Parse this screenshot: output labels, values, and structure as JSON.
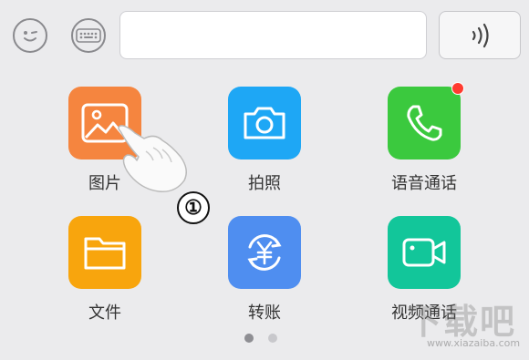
{
  "toolbar": {
    "emoji_icon": "emoji-face-icon",
    "keyboard_icon": "keyboard-icon",
    "input_value": "",
    "voice_icon": "voice-wave-icon"
  },
  "apps": [
    {
      "label": "图片",
      "icon": "image-icon",
      "color": "#f5853f"
    },
    {
      "label": "拍照",
      "icon": "camera-icon",
      "color": "#1ea7f5"
    },
    {
      "label": "语音通话",
      "icon": "phone-icon",
      "color": "#3bc93e",
      "badge": true
    },
    {
      "label": "文件",
      "icon": "folder-icon",
      "color": "#f8a50d"
    },
    {
      "label": "转账",
      "icon": "transfer-yuan-icon",
      "color": "#4f8ef0"
    },
    {
      "label": "视频通话",
      "icon": "video-camera-icon",
      "color": "#12c69a"
    }
  ],
  "pagination": {
    "pages": 2,
    "current": 1
  },
  "annotation": {
    "step_marker": "①"
  },
  "watermark": {
    "text": "下载吧",
    "url": "www.xiazaiba.com"
  }
}
